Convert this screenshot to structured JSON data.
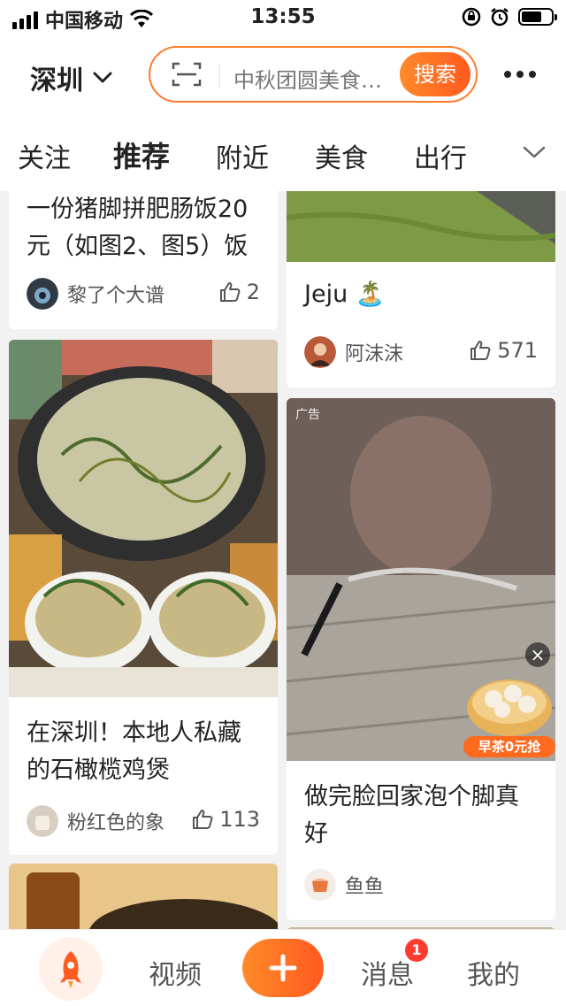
{
  "status_bar": {
    "carrier": "中国移动",
    "time": "13:55"
  },
  "header": {
    "city": "深圳",
    "search_placeholder": "中秋团圆美食…",
    "search_button": "搜索"
  },
  "tabs": [
    {
      "label": "关注"
    },
    {
      "label": "推荐",
      "active": true
    },
    {
      "label": "附近"
    },
    {
      "label": "美食"
    },
    {
      "label": "出行"
    }
  ],
  "feed": {
    "left": [
      {
        "title": "一份猪脚拼肥肠饭20元（如图2、图5）饭",
        "author": "黎了个大谱",
        "likes": "2"
      },
      {
        "title": "在深圳！本地人私藏的石橄榄鸡煲",
        "author": "粉红色的象",
        "likes": "113"
      }
    ],
    "right": [
      {
        "title": "Jeju 🏝️",
        "author": "阿沫沫",
        "likes": "571"
      },
      {
        "ad_label": "广告",
        "promo_text": "早茶0元抢",
        "title": "做完脸回家泡个脚真好",
        "author": "鱼鱼"
      }
    ]
  },
  "bottom_nav": {
    "video": "视频",
    "messages": "消息",
    "messages_badge": "1",
    "me": "我的"
  },
  "colors": {
    "accent": "#ff6a1f",
    "badge": "#ff3b30"
  }
}
